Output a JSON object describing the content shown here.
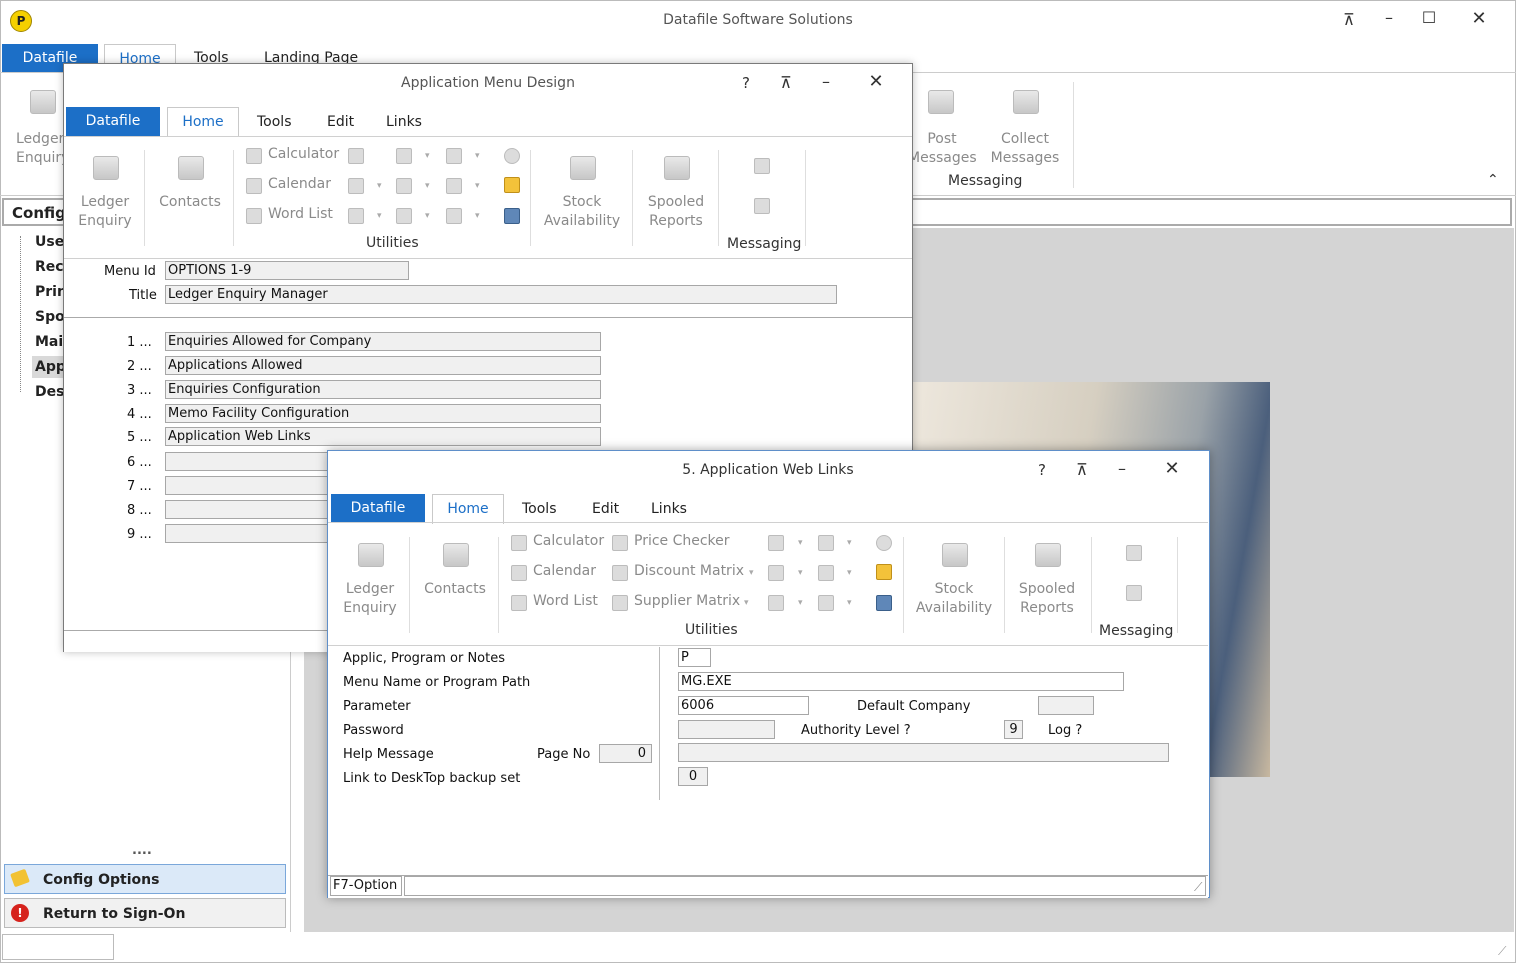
{
  "main_window": {
    "title": "Datafile Software Solutions",
    "tabs": [
      "Datafile",
      "Home",
      "Tools",
      "Landing Page"
    ],
    "ribbon_left_label": [
      "Ledger",
      "Enquiry"
    ],
    "messaging": {
      "post": [
        "Post",
        "Messages"
      ],
      "collect": [
        "Collect",
        "Messages"
      ],
      "group": "Messaging"
    },
    "sidebar": {
      "header": "Config",
      "items": [
        "Use",
        "Rec",
        "Prin",
        "Spo",
        "Mai",
        "App",
        "Des"
      ],
      "dots": "....",
      "config_options": "Config Options",
      "return_signon": "Return to Sign-On"
    }
  },
  "menu_design": {
    "title": "Application Menu Design",
    "tabs": [
      "Datafile",
      "Home",
      "Tools",
      "Edit",
      "Links"
    ],
    "ribbon": {
      "ledger": [
        "Ledger",
        "Enquiry"
      ],
      "contacts": "Contacts",
      "calculator": "Calculator",
      "calendar": "Calendar",
      "word_list": "Word List",
      "utilities": "Utilities",
      "stock": [
        "Stock",
        "Availability"
      ],
      "spooled": [
        "Spooled",
        "Reports"
      ],
      "messaging": "Messaging"
    },
    "menu_id_label": "Menu Id",
    "menu_id": "OPTIONS 1-9",
    "title_label": "Title",
    "title_value": "Ledger Enquiry Manager",
    "options": [
      {
        "num": "1 ...",
        "value": "Enquiries Allowed for Company"
      },
      {
        "num": "2 ...",
        "value": "Applications Allowed"
      },
      {
        "num": "3 ...",
        "value": "Enquiries Configuration"
      },
      {
        "num": "4 ...",
        "value": "Memo Facility Configuration"
      },
      {
        "num": "5 ...",
        "value": "Application Web Links"
      },
      {
        "num": "6 ...",
        "value": ""
      },
      {
        "num": "7 ...",
        "value": ""
      },
      {
        "num": "8 ...",
        "value": ""
      },
      {
        "num": "9 ...",
        "value": ""
      }
    ]
  },
  "web_links": {
    "title": "5. Application Web Links",
    "tabs": [
      "Datafile",
      "Home",
      "Tools",
      "Edit",
      "Links"
    ],
    "ribbon": {
      "ledger": [
        "Ledger",
        "Enquiry"
      ],
      "contacts": "Contacts",
      "calculator": "Calculator",
      "calendar": "Calendar",
      "word_list": "Word List",
      "price_checker": "Price Checker",
      "discount_matrix": "Discount Matrix",
      "supplier_matrix": "Supplier Matrix",
      "utilities": "Utilities",
      "stock": [
        "Stock",
        "Availability"
      ],
      "spooled": [
        "Spooled",
        "Reports"
      ],
      "messaging": "Messaging"
    },
    "form": {
      "applic_label": "Applic, Program or Notes",
      "applic_value": "P",
      "menu_name_label": "Menu Name or Program Path",
      "menu_name_value": "MG.EXE",
      "parameter_label": "Parameter",
      "parameter_value": "6006",
      "default_company_label": "Default Company",
      "default_company_value": "",
      "password_label": "Password",
      "password_value": "",
      "authority_label": "Authority Level ?",
      "authority_value": "9",
      "log_label": "Log ?",
      "help_label": "Help Message",
      "page_no_label": "Page No",
      "page_no_value": "0",
      "help_value": "",
      "link_label": "Link to DeskTop backup set",
      "link_value": "0"
    },
    "status": {
      "f7": "F7-Option",
      "message": ""
    }
  }
}
